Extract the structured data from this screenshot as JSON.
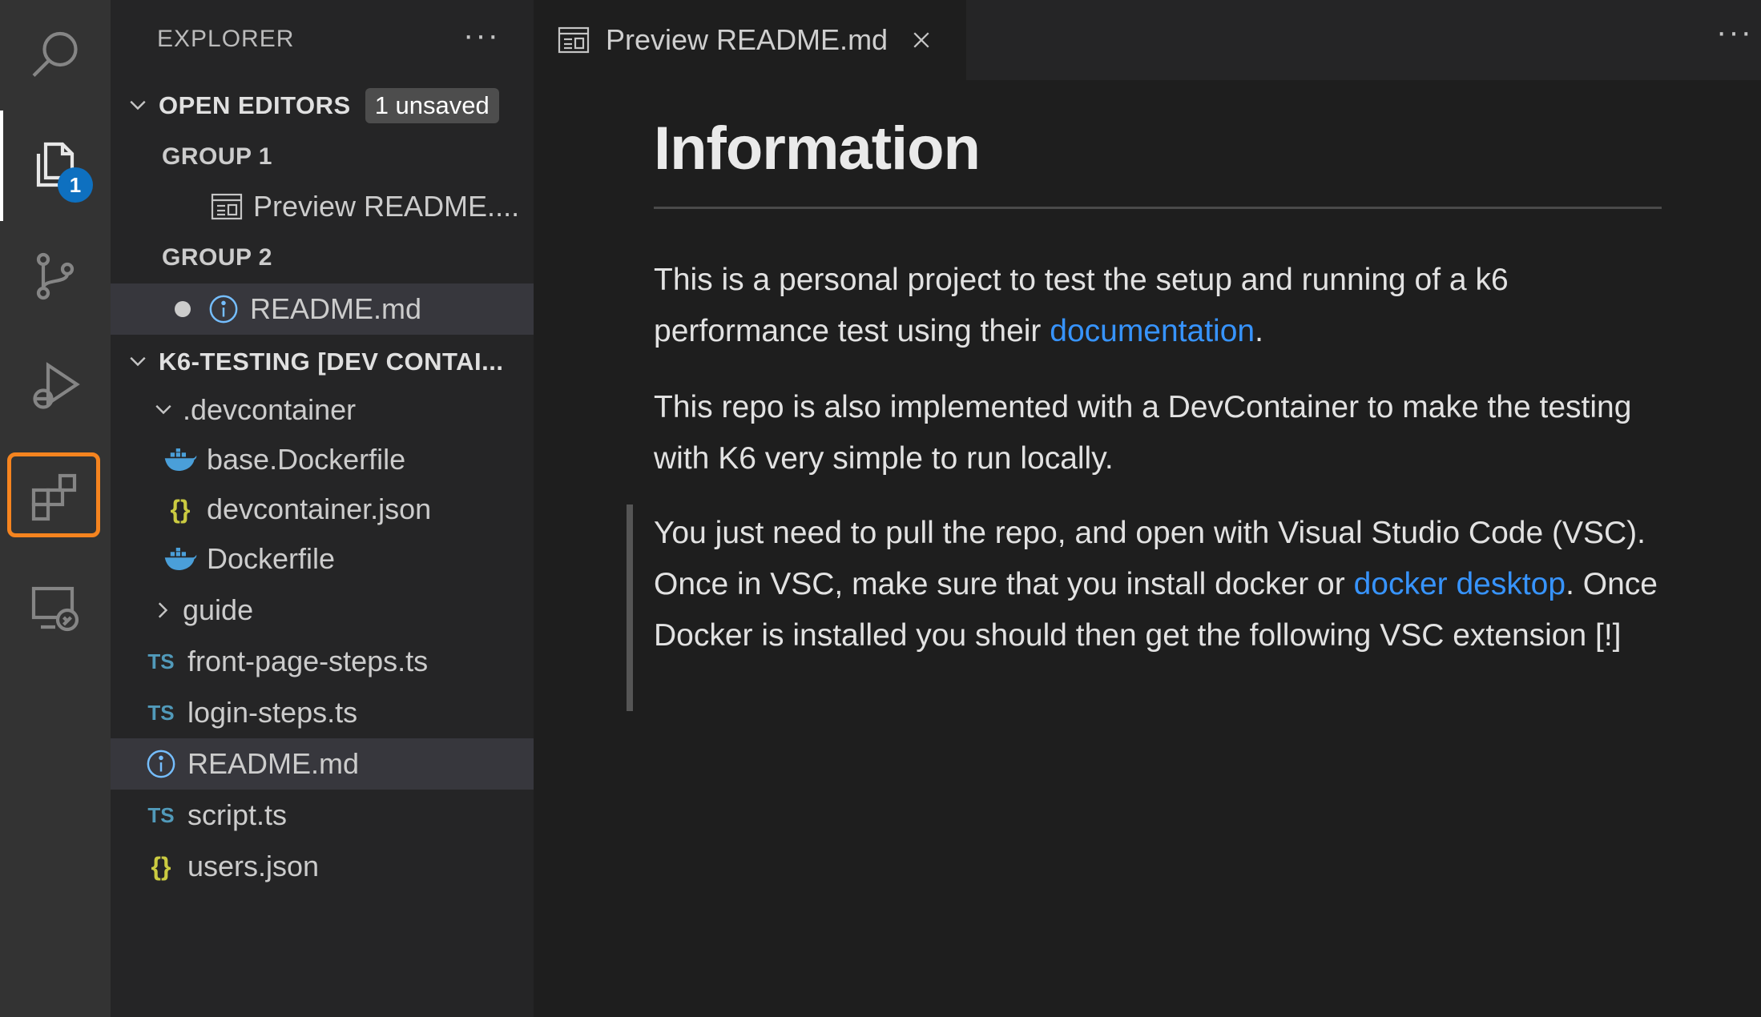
{
  "activity_bar": {
    "items": [
      {
        "icon": "search-icon"
      },
      {
        "icon": "files-icon",
        "badge": "1"
      },
      {
        "icon": "source-control-icon"
      },
      {
        "icon": "run-debug-icon"
      },
      {
        "icon": "extensions-icon"
      },
      {
        "icon": "remote-explorer-icon"
      }
    ],
    "highlight_color": "#f5841f"
  },
  "sidebar": {
    "title": "EXPLORER",
    "more": "···",
    "open_editors": {
      "label": "OPEN EDITORS",
      "badge": "1 unsaved",
      "groups": [
        {
          "label": "GROUP 1",
          "files": [
            {
              "name": "Preview README....",
              "icon": "preview-icon"
            }
          ]
        },
        {
          "label": "GROUP 2",
          "files": [
            {
              "name": "README.md",
              "icon": "info-icon",
              "unsaved": true
            }
          ]
        }
      ]
    },
    "project": {
      "label": "K6-TESTING [DEV CONTAI...",
      "tree": [
        {
          "name": ".devcontainer",
          "type": "folder-open"
        },
        {
          "name": "base.Dockerfile",
          "icon": "docker-icon"
        },
        {
          "name": "devcontainer.json",
          "icon": "json-icon",
          "glyph": "{}"
        },
        {
          "name": "Dockerfile",
          "icon": "docker-icon"
        },
        {
          "name": "guide",
          "type": "folder-closed"
        },
        {
          "name": "front-page-steps.ts",
          "icon": "typescript-icon",
          "glyph": "TS"
        },
        {
          "name": "login-steps.ts",
          "icon": "typescript-icon",
          "glyph": "TS"
        },
        {
          "name": "README.md",
          "icon": "info-icon"
        },
        {
          "name": "script.ts",
          "icon": "typescript-icon",
          "glyph": "TS"
        },
        {
          "name": "users.json",
          "icon": "json-icon",
          "glyph": "{}"
        }
      ]
    }
  },
  "tabs": [
    {
      "label": "Preview README.md",
      "icon": "preview-icon",
      "active": true
    }
  ],
  "tab_more": "···",
  "preview": {
    "heading": "Information",
    "p1_text": "This is a personal project to test the setup and running of a k6 performance test using their ",
    "p1_link": "documentation",
    "p1_end": ".",
    "p2_text": "This repo is also implemented with a DevContainer to make the testing with K6 very simple to run locally.",
    "q_text1": "You just need to pull the repo, and open with Visual Studio Code (VSC). Once in VSC, make sure that you install docker or ",
    "q_link": "docker desktop",
    "q_text2": ". Once Docker is installed you should then get the following VSC extension [!]"
  },
  "colors": {
    "accent_link": "#3794ff",
    "badge_blue": "#0e70c0",
    "ts_blue": "#519aba",
    "json_yellow": "#cbcb41",
    "docker_blue": "#4a9fd9"
  }
}
